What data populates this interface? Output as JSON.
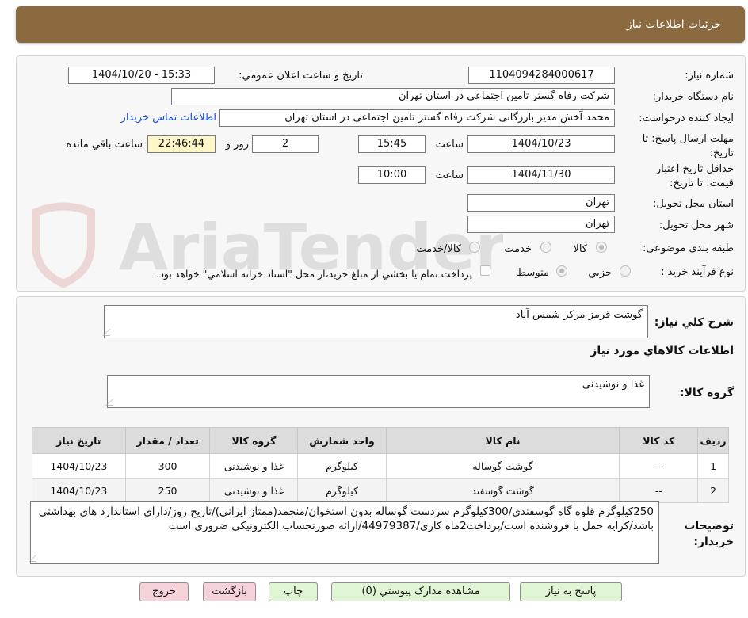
{
  "header": {
    "title": "جزئیات اطلاعات نیاز"
  },
  "watermark": {
    "text": "AriaTender.neT"
  },
  "form": {
    "need_number_label": "شماره نیاز:",
    "need_number": "1104094284000617",
    "announce_label": "تاریخ و ساعت اعلان عمومي:",
    "announce_value": "1404/10/20 - 15:33",
    "buyer_org_label": "نام دستگاه خريدار:",
    "buyer_org": "شرکت رفاه گستر تامین اجتماعی در استان تهران",
    "requester_label": "ايجاد کننده درخواست:",
    "requester": "محمد آخش مدیر بازرگانی شرکت رفاه گستر تامین اجتماعی در استان تهران",
    "contact_link": "اطلاعات تماس خريدار",
    "deadline_label": "مهلت ارسال پاسخ: تا تاريخ:",
    "deadline_date": "1404/10/23",
    "time_label": "ساعت",
    "deadline_time": "15:45",
    "days": "2",
    "days_label": "روز و",
    "remaining_time": "22:46:44",
    "remaining_label": "ساعت باقي مانده",
    "validity_label": "حداقل تاريخ اعتبار قيمت: تا تاريخ:",
    "validity_date": "1404/11/30",
    "validity_time": "10:00",
    "province_label": "استان محل تحويل:",
    "province": "تهران",
    "city_label": "شهر محل تحويل:",
    "city": "تهران",
    "category_label": "طبقه بندی موضوعی:",
    "category_options": [
      "کالا",
      "خدمت",
      "کالا/خدمت"
    ],
    "process_label": "نوع فرآيند خريد :",
    "process_options": [
      "جزيي",
      "متوسط"
    ],
    "process_note": "پرداخت تمام يا بخشي از مبلغ خريد،از محل \"اسناد خزانه اسلامي\" خواهد بود."
  },
  "summary": {
    "need_desc_label": "شرح کلي نياز:",
    "need_desc": "گوشت قرمز مرکز شمس آباد",
    "goods_info_title": "اطلاعات کالاهاي مورد نياز",
    "goods_group_label": "گروه کالا:",
    "goods_group": "غذا و نوشيدنی"
  },
  "table": {
    "headers": [
      "رديف",
      "کد کالا",
      "نام کالا",
      "واحد شمارش",
      "گروه کالا",
      "تعداد / مقدار",
      "تاريخ نياز"
    ],
    "rows": [
      [
        "1",
        "--",
        "گوشت گوساله",
        "کيلوگرم",
        "غذا و نوشيدنی",
        "300",
        "1404/10/23"
      ],
      [
        "2",
        "--",
        "گوشت گوسفند",
        "کيلوگرم",
        "غذا و نوشيدنی",
        "250",
        "1404/10/23"
      ]
    ]
  },
  "buyer_notes": {
    "label": "توضيحات خريدار:",
    "text": "250کیلوگرم قلوه گاه گوسفندی/300کیلوگرم سردست گوساله بدون استخوان/منجمد(ممتاز ایرانی)/تاریخ روز/دارای استاندارد های بهداشتی باشد/کرایه حمل با فروشنده است/پرداخت2ماه کاری/44979387/ارائه صورتحساب الکترونیکی ضروری است"
  },
  "buttons": {
    "reply": "پاسخ به نياز",
    "view_docs": "مشاهده مدارک پيوستي (0)",
    "print": "چاپ",
    "back": "بازگشت",
    "exit": "خروج"
  }
}
